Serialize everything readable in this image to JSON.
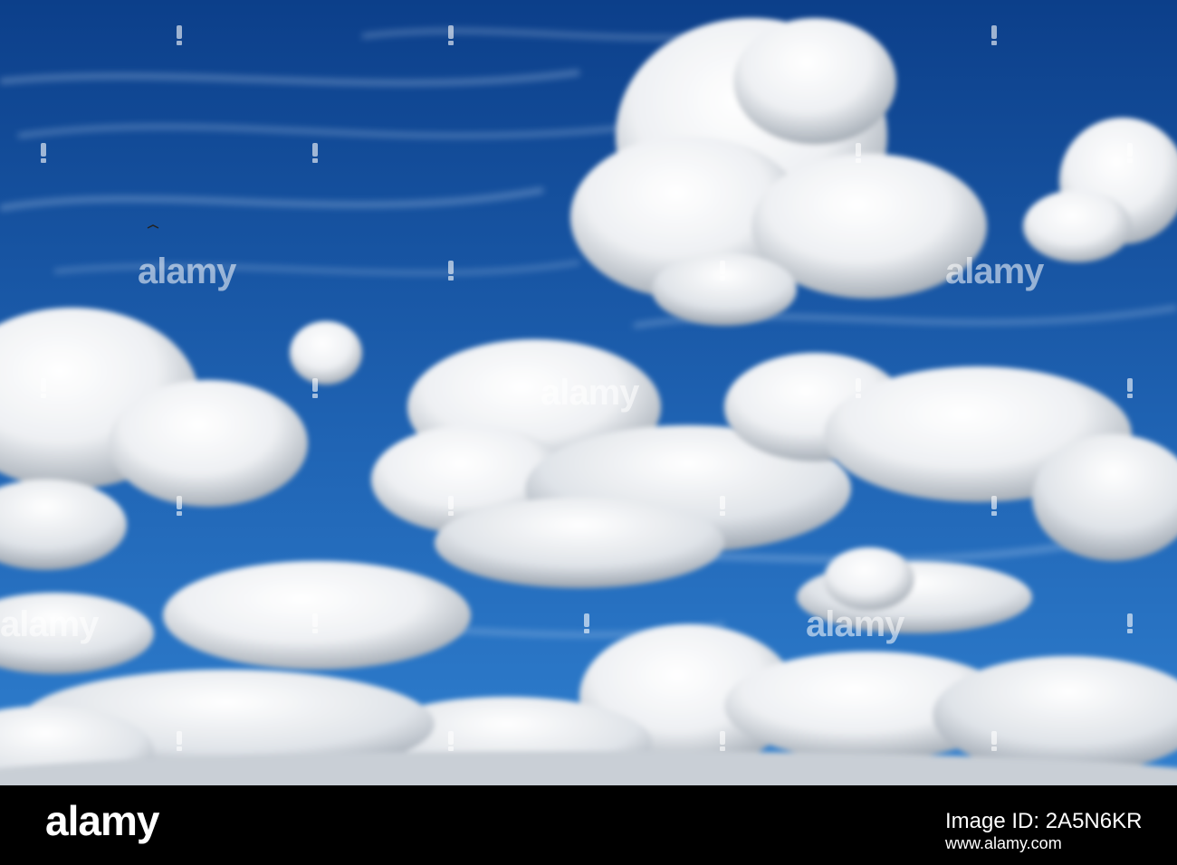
{
  "image": {
    "subject": "blue sky with white cumulus clouds",
    "colors": {
      "sky_top": "#0c3f8a",
      "sky_mid": "#1f63b3",
      "sky_bottom": "#2f7fcf",
      "cloud_light": "#ffffff",
      "cloud_shadow": "#9aa3ad",
      "footer_bg": "#000000",
      "footer_text": "#ffffff"
    }
  },
  "watermark": {
    "text": "alamy"
  },
  "footer": {
    "logo_text": "alamy",
    "image_id": "Image ID: 2A5N6KR",
    "url": "www.alamy.com"
  }
}
